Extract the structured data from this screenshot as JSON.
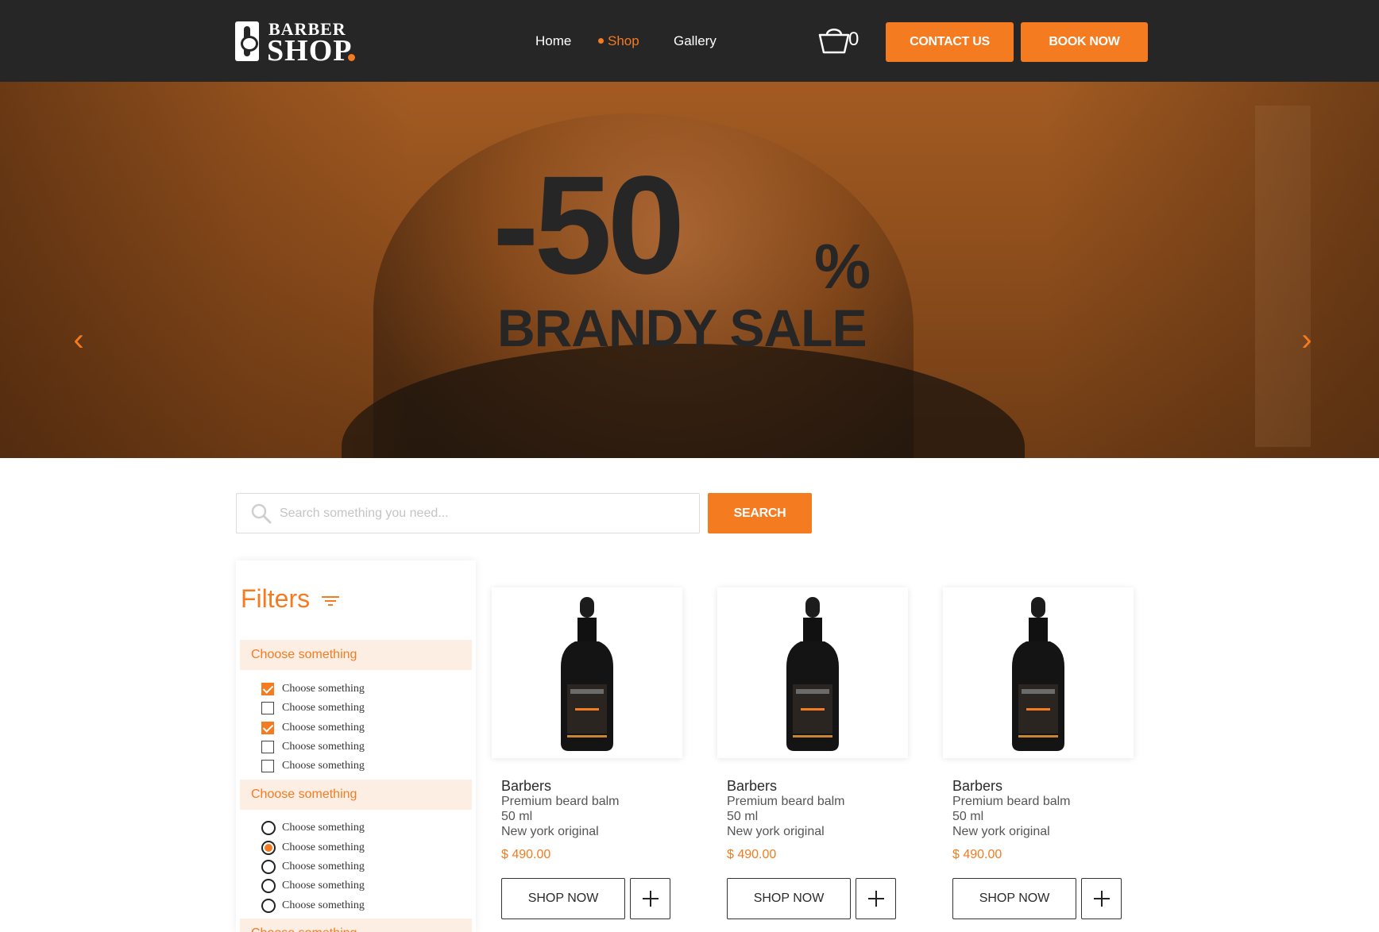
{
  "brand": {
    "line1": "BARBER",
    "line2": "SHOP"
  },
  "nav": {
    "home": "Home",
    "shop": "Shop",
    "gallery": "Gallery"
  },
  "cart": {
    "count": "0",
    "icon": "basket-icon"
  },
  "buttons": {
    "contact": "CONTACT US",
    "book": "BOOK NOW"
  },
  "hero": {
    "discount": "-50",
    "percent": "%",
    "headline": "BRANDY SALE",
    "prev_icon": "chevron-left-icon",
    "next_icon": "chevron-right-icon"
  },
  "search": {
    "placeholder": "Search something you need...",
    "button": "SEARCH"
  },
  "filters": {
    "title": "Filters",
    "groups": [
      {
        "label": "Choose something",
        "type": "checkbox",
        "options": [
          {
            "label": "Choose something",
            "checked": true
          },
          {
            "label": "Choose something",
            "checked": false
          },
          {
            "label": "Choose something",
            "checked": true
          },
          {
            "label": "Choose something",
            "checked": false
          },
          {
            "label": "Choose something",
            "checked": false
          }
        ]
      },
      {
        "label": "Choose something",
        "type": "radio",
        "options": [
          {
            "label": "Choose something",
            "checked": false
          },
          {
            "label": "Choose something",
            "checked": true
          },
          {
            "label": "Choose something",
            "checked": false
          },
          {
            "label": "Choose something",
            "checked": false
          },
          {
            "label": "Choose something",
            "checked": false
          }
        ]
      },
      {
        "label": "Choose something"
      }
    ]
  },
  "products": [
    {
      "brand": "Barbers",
      "name": "Premium beard balm",
      "size": "50 ml",
      "origin": "New york original",
      "price": "$ 490.00",
      "shop_label": "SHOP NOW"
    },
    {
      "brand": "Barbers",
      "name": "Premium beard balm",
      "size": "50 ml",
      "origin": "New york original",
      "price": "$ 490.00",
      "shop_label": "SHOP NOW"
    },
    {
      "brand": "Barbers",
      "name": "Premium beard balm",
      "size": "50 ml",
      "origin": "New york original",
      "price": "$ 490.00",
      "shop_label": "SHOP NOW"
    }
  ],
  "colors": {
    "accent": "#f47b20",
    "header_bg": "#262626",
    "filter_group_bg": "#fdeee3"
  }
}
